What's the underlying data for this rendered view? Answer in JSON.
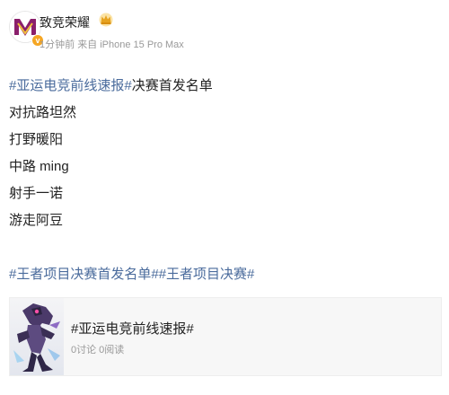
{
  "author": {
    "name": "致竞荣耀",
    "verified_icon": "verified-badge-icon",
    "level_icon": "crown-icon"
  },
  "meta": {
    "time": "1分钟前",
    "source": "来自 iPhone 15 Pro Max"
  },
  "post": {
    "line1_hashtag": "#亚运电竞前线速报#",
    "line1_text": "决赛首发名单",
    "lines": [
      "对抗路坦然",
      "打野暖阳",
      "中路 ming",
      "射手一诺",
      "游走阿豆"
    ],
    "hashtag_2": "#王者项目决赛首发名单#",
    "hashtag_3": "#王者项目决赛#"
  },
  "card": {
    "title": "#亚运电竞前线速报#",
    "stats": "0讨论 0阅读",
    "thumbnail_icon": "game-hero-thumbnail"
  },
  "colors": {
    "hashtag": "#4a6b9c",
    "muted": "#999999",
    "card_bg": "#f7f7f7",
    "badge": "#f5a623"
  }
}
